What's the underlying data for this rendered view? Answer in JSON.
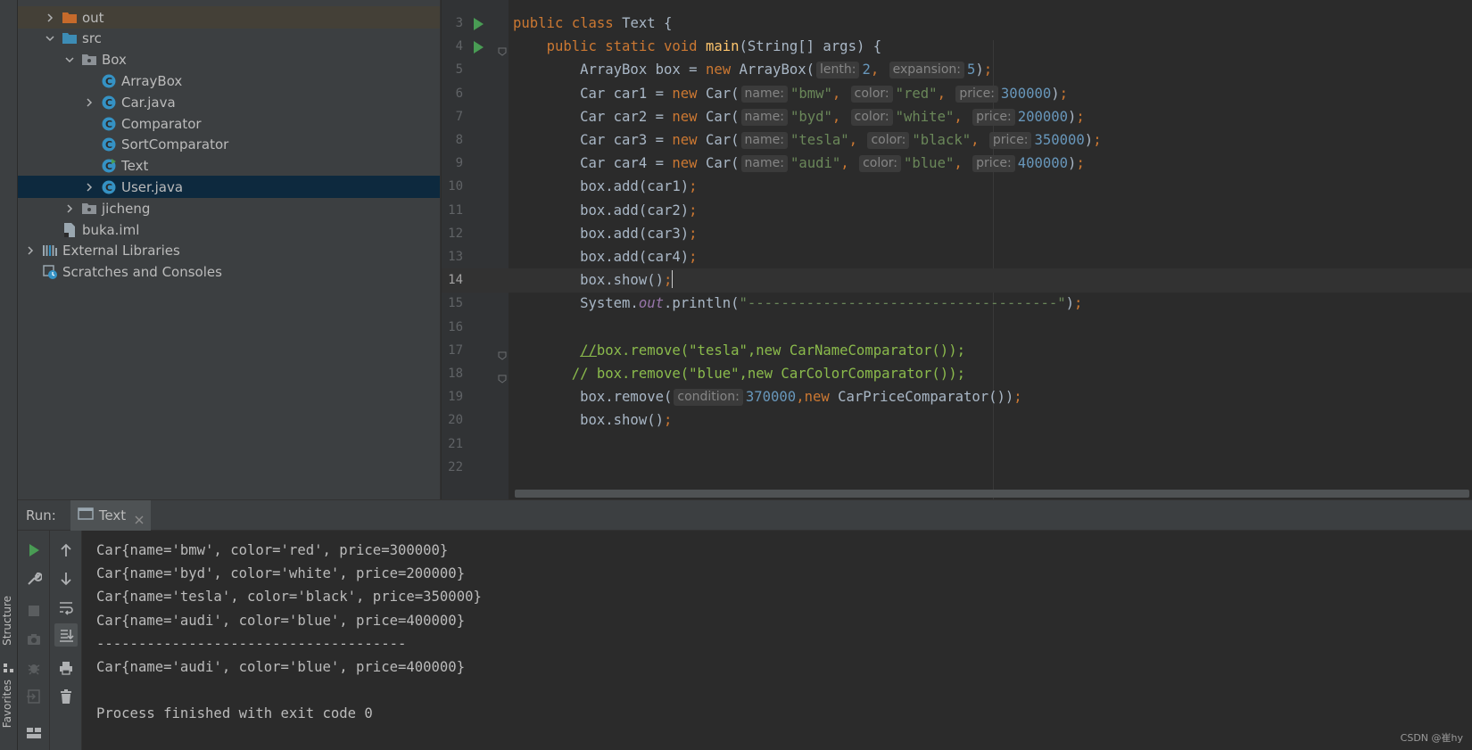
{
  "sidebar_tabs": {
    "structure": "Structure",
    "favorites": "Favorites"
  },
  "project_tree": {
    "rows": [
      {
        "label": "out",
        "indent": 1,
        "expand": "collapsed",
        "icon": "folder-orange-icon",
        "highlight": true
      },
      {
        "label": "src",
        "indent": 1,
        "expand": "expanded",
        "icon": "folder-blue-icon"
      },
      {
        "label": "Box",
        "indent": 2,
        "expand": "expanded",
        "icon": "package-icon"
      },
      {
        "label": "ArrayBox",
        "indent": 3,
        "expand": "none",
        "icon": "class-icon"
      },
      {
        "label": "Car.java",
        "indent": 3,
        "expand": "collapsed",
        "icon": "class-icon"
      },
      {
        "label": "Comparator",
        "indent": 3,
        "expand": "none",
        "icon": "class-icon"
      },
      {
        "label": "SortComparator",
        "indent": 3,
        "expand": "none",
        "icon": "class-icon"
      },
      {
        "label": "Text",
        "indent": 3,
        "expand": "none",
        "icon": "runnable-class-icon"
      },
      {
        "label": "User.java",
        "indent": 3,
        "expand": "collapsed",
        "icon": "class-icon",
        "selected": true
      },
      {
        "label": "jicheng",
        "indent": 2,
        "expand": "collapsed",
        "icon": "package-icon"
      },
      {
        "label": "buka.iml",
        "indent": 1,
        "expand": "none",
        "icon": "iml-file-icon"
      },
      {
        "label": "External Libraries",
        "indent": 0,
        "expand": "collapsed",
        "icon": "libraries-icon"
      },
      {
        "label": "Scratches and Consoles",
        "indent": 0,
        "expand": "none",
        "icon": "scratches-icon"
      }
    ]
  },
  "editor": {
    "current_line": 14,
    "lines": [
      {
        "n": "3",
        "run": true,
        "tokens": [
          [
            "kw",
            "public class "
          ],
          [
            "pl",
            "Text {"
          ]
        ]
      },
      {
        "n": "4",
        "run": true,
        "fold": true,
        "tokens": [
          [
            "pl",
            "    "
          ],
          [
            "kw",
            "public static void "
          ],
          [
            "fn",
            "main"
          ],
          [
            "pl",
            "(String[] args) {"
          ]
        ]
      },
      {
        "n": "5",
        "tokens": [
          [
            "pl",
            "        ArrayBox box = "
          ],
          [
            "kw",
            "new "
          ],
          [
            "pl",
            "ArrayBox("
          ],
          [
            "hint",
            "lenth:"
          ],
          [
            "nu",
            "2"
          ],
          [
            "kw",
            ", "
          ],
          [
            "hint",
            "expansion:"
          ],
          [
            "nu",
            "5"
          ],
          [
            "pl",
            ")"
          ],
          [
            "kw",
            ";"
          ]
        ]
      },
      {
        "n": "6",
        "tokens": [
          [
            "pl",
            "        Car car1 = "
          ],
          [
            "kw",
            "new "
          ],
          [
            "pl",
            "Car("
          ],
          [
            "hint",
            "name:"
          ],
          [
            "st",
            "\"bmw\""
          ],
          [
            "kw",
            ", "
          ],
          [
            "hint",
            "color:"
          ],
          [
            "st",
            "\"red\""
          ],
          [
            "kw",
            ", "
          ],
          [
            "hint",
            "price:"
          ],
          [
            "nu",
            "300000"
          ],
          [
            "pl",
            ")"
          ],
          [
            "kw",
            ";"
          ]
        ]
      },
      {
        "n": "7",
        "tokens": [
          [
            "pl",
            "        Car car2 = "
          ],
          [
            "kw",
            "new "
          ],
          [
            "pl",
            "Car("
          ],
          [
            "hint",
            "name:"
          ],
          [
            "st",
            "\"byd\""
          ],
          [
            "kw",
            ", "
          ],
          [
            "hint",
            "color:"
          ],
          [
            "st",
            "\"white\""
          ],
          [
            "kw",
            ", "
          ],
          [
            "hint",
            "price:"
          ],
          [
            "nu",
            "200000"
          ],
          [
            "pl",
            ")"
          ],
          [
            "kw",
            ";"
          ]
        ]
      },
      {
        "n": "8",
        "tokens": [
          [
            "pl",
            "        Car car3 = "
          ],
          [
            "kw",
            "new "
          ],
          [
            "pl",
            "Car("
          ],
          [
            "hint",
            "name:"
          ],
          [
            "st",
            "\"tesla\""
          ],
          [
            "kw",
            ", "
          ],
          [
            "hint",
            "color:"
          ],
          [
            "st",
            "\"black\""
          ],
          [
            "kw",
            ", "
          ],
          [
            "hint",
            "price:"
          ],
          [
            "nu",
            "350000"
          ],
          [
            "pl",
            ")"
          ],
          [
            "kw",
            ";"
          ]
        ]
      },
      {
        "n": "9",
        "tokens": [
          [
            "pl",
            "        Car car4 = "
          ],
          [
            "kw",
            "new "
          ],
          [
            "pl",
            "Car("
          ],
          [
            "hint",
            "name:"
          ],
          [
            "st",
            "\"audi\""
          ],
          [
            "kw",
            ", "
          ],
          [
            "hint",
            "color:"
          ],
          [
            "st",
            "\"blue\""
          ],
          [
            "kw",
            ", "
          ],
          [
            "hint",
            "price:"
          ],
          [
            "nu",
            "400000"
          ],
          [
            "pl",
            ")"
          ],
          [
            "kw",
            ";"
          ]
        ]
      },
      {
        "n": "10",
        "tokens": [
          [
            "pl",
            "        box.add(car1)"
          ],
          [
            "kw",
            ";"
          ]
        ]
      },
      {
        "n": "11",
        "tokens": [
          [
            "pl",
            "        box.add(car2)"
          ],
          [
            "kw",
            ";"
          ]
        ]
      },
      {
        "n": "12",
        "tokens": [
          [
            "pl",
            "        box.add(car3)"
          ],
          [
            "kw",
            ";"
          ]
        ]
      },
      {
        "n": "13",
        "tokens": [
          [
            "pl",
            "        box.add(car4)"
          ],
          [
            "kw",
            ";"
          ]
        ]
      },
      {
        "n": "14",
        "tokens": [
          [
            "pl",
            "        box.show()"
          ],
          [
            "kw",
            ";"
          ],
          [
            "caret",
            ""
          ]
        ]
      },
      {
        "n": "15",
        "tokens": [
          [
            "pl",
            "        System."
          ],
          [
            "it",
            "out"
          ],
          [
            "pl",
            ".println("
          ],
          [
            "st",
            "\"-------------------------------------\""
          ],
          [
            "pl",
            ")"
          ],
          [
            "kw",
            ";"
          ]
        ]
      },
      {
        "n": "16",
        "tokens": []
      },
      {
        "n": "17",
        "fold": true,
        "tokens": [
          [
            "pl",
            "        "
          ],
          [
            "cmu",
            "//"
          ],
          [
            "cm",
            "box.remove(\"tesla\",new CarNameComparator());"
          ]
        ]
      },
      {
        "n": "18",
        "fold": true,
        "tokens": [
          [
            "pl",
            "       "
          ],
          [
            "cm",
            "// box.remove(\"blue\",new CarColorComparator());"
          ]
        ]
      },
      {
        "n": "19",
        "tokens": [
          [
            "pl",
            "        box.remove("
          ],
          [
            "hint",
            "condition:"
          ],
          [
            "nu",
            "370000"
          ],
          [
            "kw",
            ",new "
          ],
          [
            "pl",
            "CarPriceComparator())"
          ],
          [
            "kw",
            ";"
          ]
        ]
      },
      {
        "n": "20",
        "tokens": [
          [
            "pl",
            "        box.show()"
          ],
          [
            "kw",
            ";"
          ]
        ]
      },
      {
        "n": "21",
        "tokens": []
      },
      {
        "n": "22",
        "tokens": []
      }
    ]
  },
  "run_panel": {
    "label": "Run:",
    "tab_label": "Text",
    "console_lines": [
      "Car{name='bmw', color='red', price=300000}",
      "Car{name='byd', color='white', price=200000}",
      "Car{name='tesla', color='black', price=350000}",
      "Car{name='audi', color='blue', price=400000}",
      "-------------------------------------",
      "Car{name='audi', color='blue', price=400000}",
      "",
      "Process finished with exit code 0"
    ]
  },
  "watermark": "CSDN @崔hy",
  "colors": {
    "keyword": "#cc7832",
    "string": "#6a8759",
    "number": "#6897bb",
    "function": "#ffc66d",
    "comment": "#8bbb4c",
    "field": "#9876aa",
    "selection": "#0d293e",
    "run": "#499c54"
  }
}
